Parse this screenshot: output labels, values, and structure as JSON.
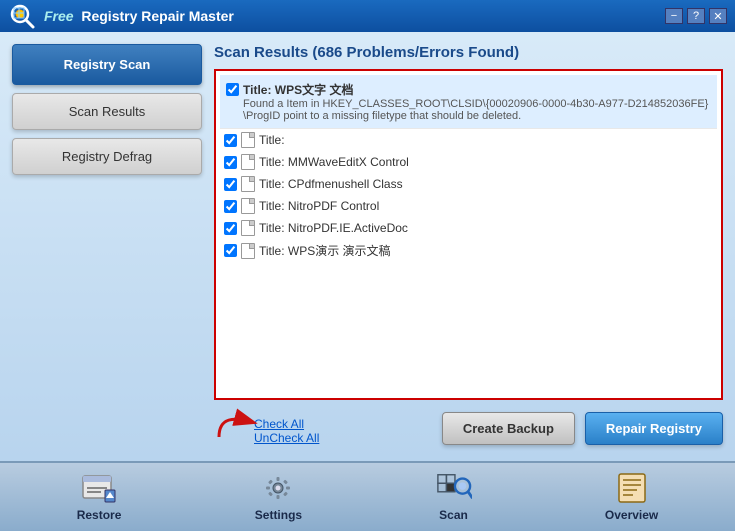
{
  "app": {
    "title_free": "Free",
    "title_main": "Registry Repair Master",
    "minimize": "−",
    "help": "?",
    "close": "✕"
  },
  "sidebar": {
    "items": [
      {
        "id": "registry-scan",
        "label": "Registry Scan",
        "active": true,
        "style": "primary"
      },
      {
        "id": "scan-results",
        "label": "Scan Results",
        "active": false,
        "style": "plain"
      },
      {
        "id": "registry-defrag",
        "label": "Registry Defrag",
        "active": false,
        "style": "plain"
      }
    ]
  },
  "main": {
    "panel_title": "Scan Results (686 Problems/Errors Found)",
    "results": [
      {
        "id": 0,
        "checked": true,
        "title": "Title: WPS文字 文档",
        "detail": "Found a Item in HKEY_CLASSES_ROOT\\CLSID\\{00020906-0000-4b30-A977-D214852036FE}\\ProgID point to a missing filetype that should be deleted.",
        "type": "expanded"
      },
      {
        "id": 1,
        "checked": true,
        "title": "Title:",
        "detail": "",
        "type": "simple"
      },
      {
        "id": 2,
        "checked": true,
        "title": "Title: MMWaveEditX Control",
        "detail": "",
        "type": "simple"
      },
      {
        "id": 3,
        "checked": true,
        "title": "Title: CPdfmenushell Class",
        "detail": "",
        "type": "simple"
      },
      {
        "id": 4,
        "checked": true,
        "title": "Title: NitroPDF Control",
        "detail": "",
        "type": "simple"
      },
      {
        "id": 5,
        "checked": true,
        "title": "Title: NitroPDF.IE.ActiveDoc",
        "detail": "",
        "type": "simple"
      },
      {
        "id": 6,
        "checked": true,
        "title": "Title: WPS演示 演示文稿",
        "detail": "",
        "type": "simple"
      }
    ],
    "check_all": "Check All",
    "uncheck_all": "UnCheck All",
    "btn_backup": "Create Backup",
    "btn_repair": "Repair Registry"
  },
  "footer": {
    "items": [
      {
        "id": "restore",
        "label": "Restore",
        "icon": "restore"
      },
      {
        "id": "settings",
        "label": "Settings",
        "icon": "settings"
      },
      {
        "id": "scan",
        "label": "Scan",
        "icon": "scan"
      },
      {
        "id": "overview",
        "label": "Overview",
        "icon": "overview"
      }
    ]
  }
}
